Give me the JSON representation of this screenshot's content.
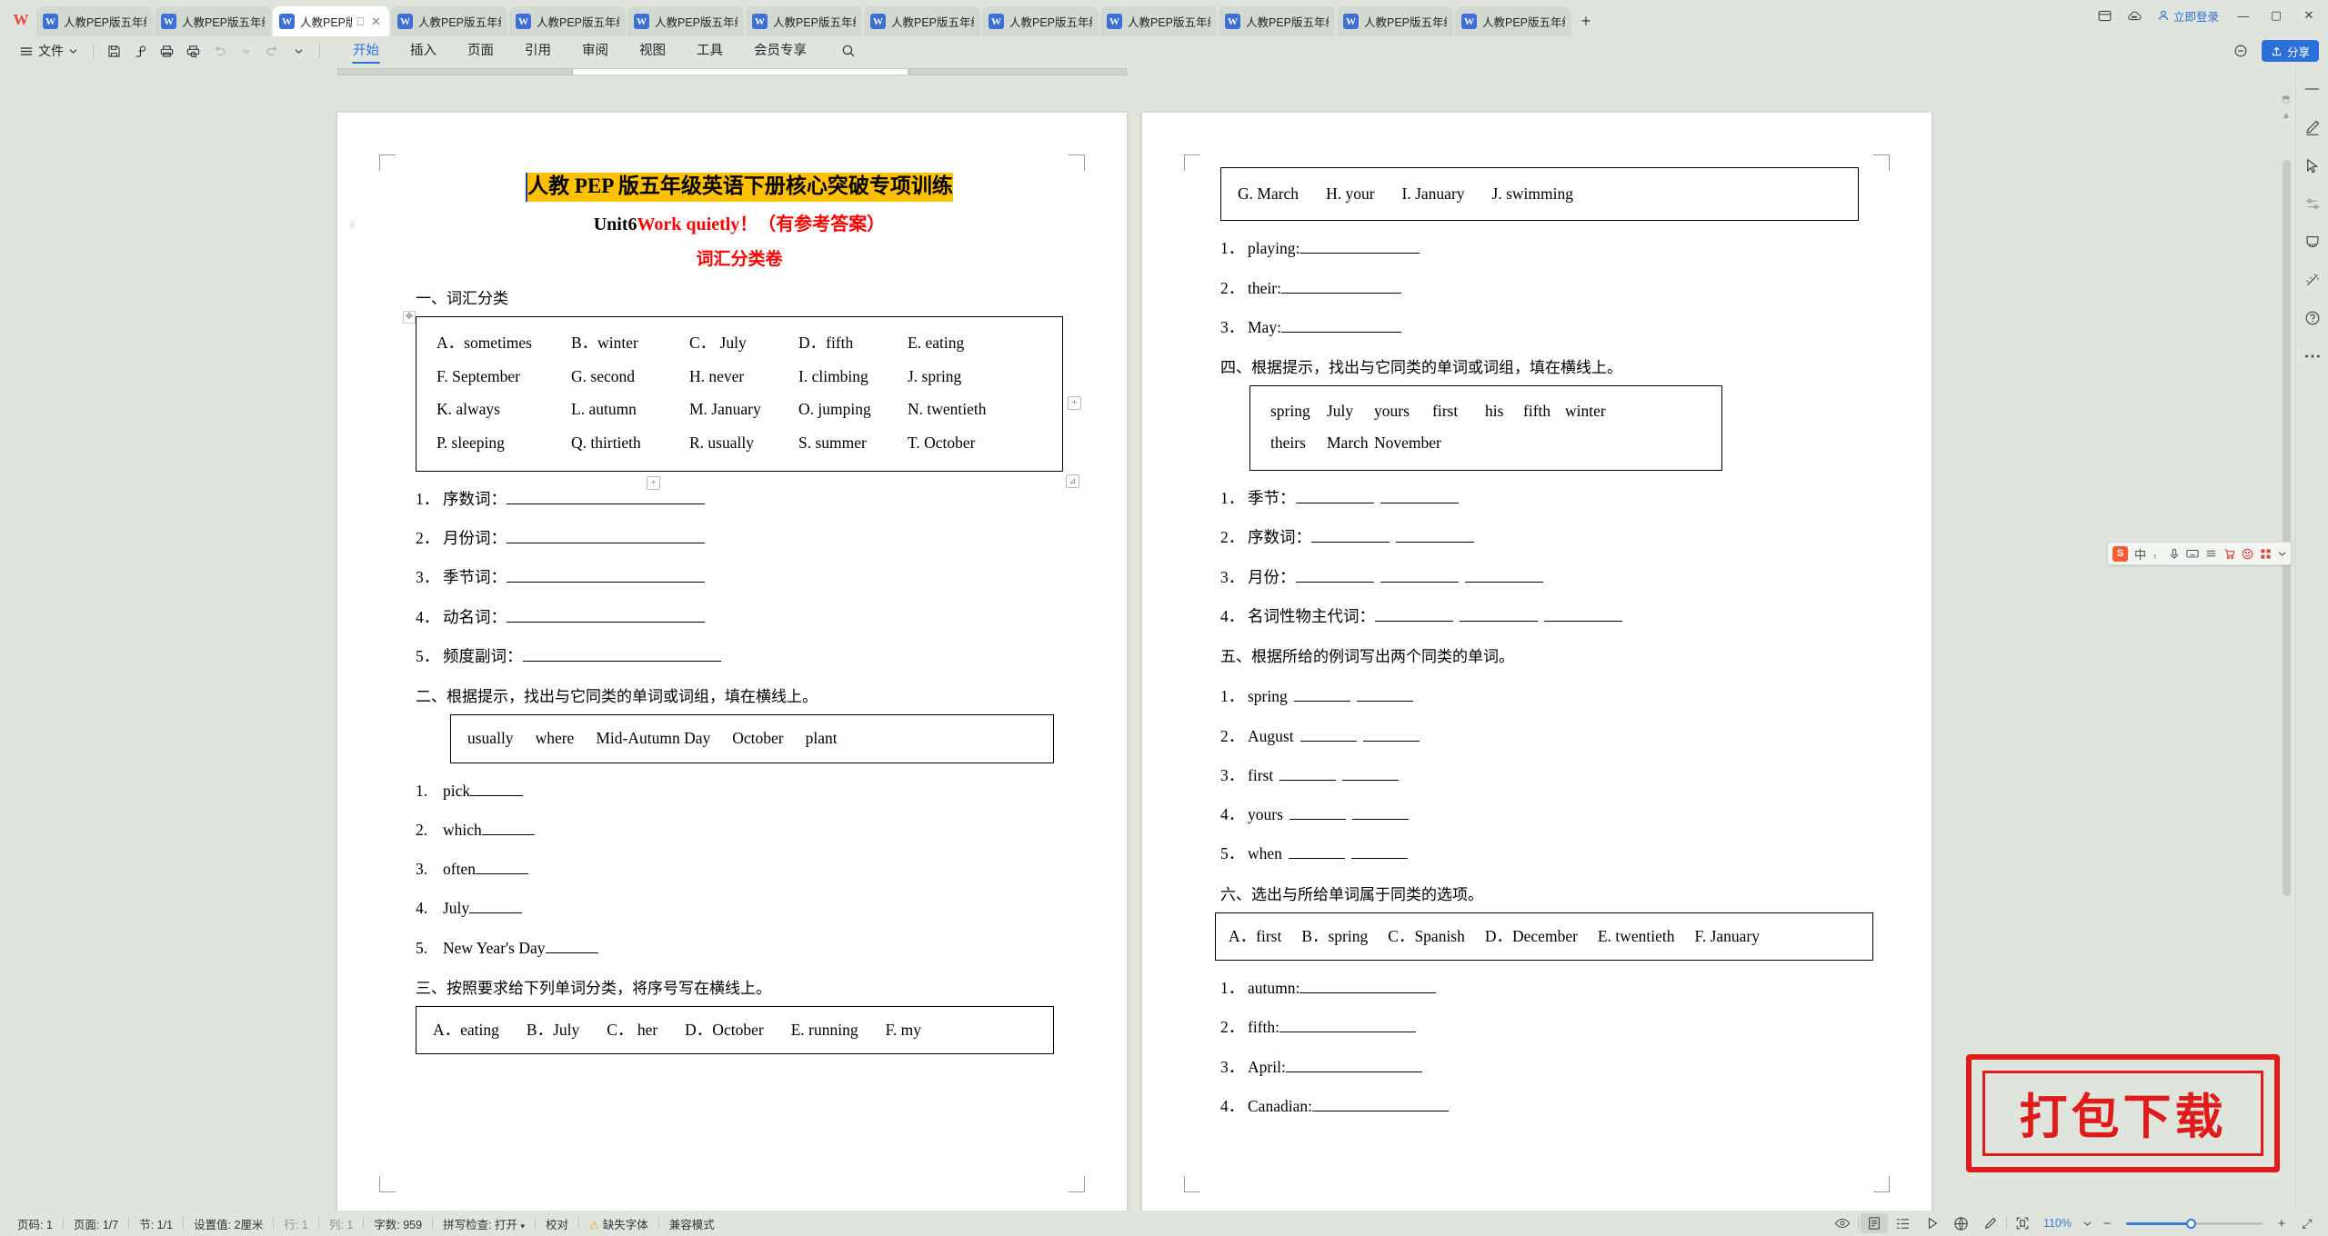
{
  "app": {
    "logo": "W",
    "tabs": [
      {
        "label": "人教PEP版五年级下f",
        "active": false
      },
      {
        "label": "人教PEP版五年级下f",
        "active": false
      },
      {
        "label": "人教PEP版五…",
        "active": true
      },
      {
        "label": "人教PEP版五年级下f",
        "active": false
      },
      {
        "label": "人教PEP版五年级下f",
        "active": false
      },
      {
        "label": "人教PEP版五年级下f",
        "active": false
      },
      {
        "label": "人教PEP版五年级下f",
        "active": false
      },
      {
        "label": "人教PEP版五年级下f",
        "active": false
      },
      {
        "label": "人教PEP版五年级下f",
        "active": false
      },
      {
        "label": "人教PEP版五年级下f",
        "active": false
      },
      {
        "label": "人教PEP版五年级下f",
        "active": false
      },
      {
        "label": "人教PEP版五年级下f",
        "active": false
      },
      {
        "label": "人教PEP版五年级下f",
        "active": false
      }
    ],
    "tab_icon_letter": "W",
    "new_tab_label": "+",
    "login_label": "立即登录",
    "window_minimize": "—",
    "window_maximize": "▢",
    "window_close": "✕"
  },
  "ribbon": {
    "file_label": "文件",
    "tabs": [
      {
        "label": "开始",
        "active": true
      },
      {
        "label": "插入",
        "active": false
      },
      {
        "label": "页面",
        "active": false
      },
      {
        "label": "引用",
        "active": false
      },
      {
        "label": "审阅",
        "active": false
      },
      {
        "label": "视图",
        "active": false
      },
      {
        "label": "工具",
        "active": false
      },
      {
        "label": "会员专享",
        "active": false
      }
    ],
    "share_label": "分享",
    "quick_access": [
      "save-icon",
      "save-as-icon",
      "print-icon",
      "print-preview-icon",
      "undo-icon",
      "redo-icon",
      "customize-icon"
    ]
  },
  "document": {
    "title_highlighted": "人教 PEP 版五年级英语下册核心突破专项训练",
    "subtitle_black": "Unit6",
    "subtitle_red": "Work quietly！",
    "subtitle_black2": "（有参考答案）",
    "subtitle2": "词汇分类卷",
    "sections": {
      "s1_head": "一、词汇分类",
      "s1_wordbox": [
        [
          "A．sometimes",
          "B．winter",
          "C． July",
          "D．fifth",
          "E. eating"
        ],
        [
          "F. September",
          "G. second",
          "H. never",
          "I. climbing",
          "J. spring"
        ],
        [
          "K. always",
          "L. autumn",
          "M. January",
          "O. jumping",
          "N. twentieth"
        ],
        [
          "P. sleeping",
          "Q. thirtieth",
          "R. usually",
          "S. summer",
          "T. October"
        ]
      ],
      "s1_items": [
        {
          "num": "1．",
          "label": "序数词："
        },
        {
          "num": "2．",
          "label": "月份词："
        },
        {
          "num": "3．",
          "label": "季节词："
        },
        {
          "num": "4．",
          "label": "动名词："
        },
        {
          "num": "5．",
          "label": "频度副词："
        }
      ],
      "s2_head": "二、根据提示，找出与它同类的单词或词组，填在横线上。",
      "s2_wordbox": [
        "usually",
        "where",
        "Mid-Autumn Day",
        "October",
        "plant"
      ],
      "s2_items": [
        {
          "num": "1.",
          "label": "pick"
        },
        {
          "num": "2.",
          "label": "which "
        },
        {
          "num": "3.",
          "label": "often "
        },
        {
          "num": "4.",
          "label": "July "
        },
        {
          "num": "5.",
          "label": "New Year's Day "
        }
      ],
      "s3_head": "三、按照要求给下列单词分类，将序号写在横线上。",
      "s3_wordbox": [
        "A．eating",
        "B．July",
        "C． her",
        "D．October",
        "E. running",
        "F. my"
      ],
      "s3_wordbox2": [
        "G. March",
        "H. your",
        "I. January",
        "J. swimming"
      ],
      "s3_items": [
        {
          "num": "1．",
          "label": "playing:"
        },
        {
          "num": "2．",
          "label": "their:"
        },
        {
          "num": "3．",
          "label": "May:"
        }
      ],
      "s4_head": "四、根据提示，找出与它同类的单词或词组，填在横线上。",
      "s4_wordbox": [
        [
          "spring",
          "July",
          "yours",
          "first",
          "his",
          "fifth",
          "winter"
        ],
        [
          "theirs",
          "March",
          "November"
        ]
      ],
      "s4_items": [
        {
          "num": "1．",
          "label": "季节：",
          "blanks": 2
        },
        {
          "num": "2．",
          "label": "序数词：",
          "blanks": 2
        },
        {
          "num": "3．",
          "label": "月份：",
          "blanks": 3
        },
        {
          "num": "4．",
          "label": "名词性物主代词：",
          "blanks": 3
        }
      ],
      "s5_head": "五、根据所给的例词写出两个同类的单词。",
      "s5_items": [
        {
          "num": "1．",
          "label": "spring"
        },
        {
          "num": "2．",
          "label": "August"
        },
        {
          "num": "3．",
          "label": "first"
        },
        {
          "num": "4．",
          "label": "yours"
        },
        {
          "num": "5．",
          "label": "when"
        }
      ],
      "s6_head": "六、选出与所给单词属于同类的选项。",
      "s6_wordbox": [
        "A．first",
        "B．spring",
        "C．Spanish",
        "D．December",
        "E. twentieth",
        "F. January"
      ],
      "s6_items": [
        {
          "num": "1．",
          "label": "autumn:"
        },
        {
          "num": "2．",
          "label": "fifth:"
        },
        {
          "num": "3．",
          "label": "April:"
        },
        {
          "num": "4．",
          "label": "Canadian:"
        }
      ]
    }
  },
  "watermark": {
    "text": "打包下载",
    "color": "#e01b1b"
  },
  "ime": {
    "logo": "S",
    "items": [
      "中",
      "，",
      "mic-icon",
      "keyboard-icon",
      "list-icon",
      "cart-icon",
      "smiley-icon",
      "grid-icon",
      "chevron-icon"
    ]
  },
  "statusbar": {
    "left": [
      {
        "text": "页码: 1",
        "dim": false
      },
      {
        "text": "页面: 1/7",
        "dim": false
      },
      {
        "text": "节: 1/1",
        "dim": false
      },
      {
        "text": "设置值: 2厘米",
        "dim": false
      },
      {
        "text": "行: 1",
        "dim": true
      },
      {
        "text": "列: 1",
        "dim": true
      },
      {
        "text": "字数: 959",
        "dim": false
      },
      {
        "text": "拼写检查: 打开",
        "dim": false
      },
      {
        "text": "校对",
        "dim": false
      },
      {
        "text": "缺失字体",
        "dim": false
      },
      {
        "text": "兼容模式",
        "dim": false
      }
    ],
    "zoom": "110%",
    "view_icons": [
      "eye-icon",
      "page-view-icon",
      "outline-view-icon",
      "play-icon",
      "web-view-icon",
      "pen-icon",
      "fit-page-icon"
    ],
    "zoom_out": "−",
    "zoom_in": "+",
    "fullscreen": "⤢"
  },
  "rail": {
    "icons": [
      "collapse-icon",
      "pen-icon",
      "cursor-icon",
      "sliders-icon",
      "shape-icon",
      "magic-icon",
      "help-icon",
      "more-icon"
    ]
  }
}
